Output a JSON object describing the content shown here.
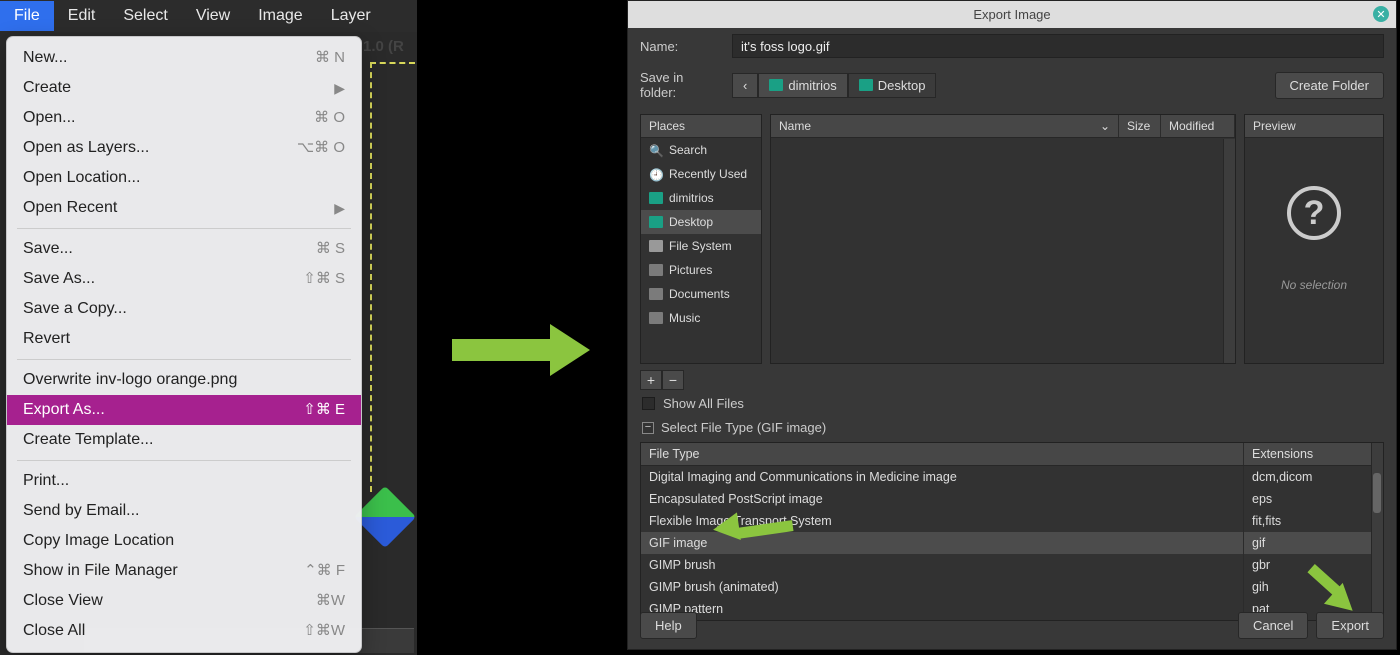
{
  "menubar": [
    "File",
    "Edit",
    "Select",
    "View",
    "Image",
    "Layer"
  ],
  "tab_fragment": "1.0 (R",
  "file_menu": {
    "new": {
      "label": "New...",
      "shortcut": "⌘ N"
    },
    "create": {
      "label": "Create",
      "submenu": true
    },
    "open": {
      "label": "Open...",
      "shortcut": "⌘ O"
    },
    "open_layers": {
      "label": "Open as Layers...",
      "shortcut": "⌥⌘ O"
    },
    "open_loc": {
      "label": "Open Location..."
    },
    "open_recent": {
      "label": "Open Recent",
      "submenu": true
    },
    "save": {
      "label": "Save...",
      "shortcut": "⌘ S"
    },
    "save_as": {
      "label": "Save As...",
      "shortcut": "⇧⌘ S"
    },
    "save_copy": {
      "label": "Save a Copy..."
    },
    "revert": {
      "label": "Revert"
    },
    "overwrite": {
      "label": "Overwrite inv-logo orange.png"
    },
    "export_as": {
      "label": "Export As...",
      "shortcut": "⇧⌘ E"
    },
    "create_tpl": {
      "label": "Create Template..."
    },
    "print": {
      "label": "Print..."
    },
    "send_email": {
      "label": "Send by Email..."
    },
    "copy_loc": {
      "label": "Copy Image Location"
    },
    "show_fm": {
      "label": "Show in File Manager",
      "shortcut": "⌃⌘ F"
    },
    "close_view": {
      "label": "Close View",
      "shortcut": "⌘W"
    },
    "close_all": {
      "label": "Close All",
      "shortcut": "⇧⌘W"
    }
  },
  "dialog": {
    "title": "Export Image",
    "name_label": "Name:",
    "name_value": "it's foss logo.gif",
    "save_in_label": "Save in folder:",
    "path": [
      "dimitrios",
      "Desktop"
    ],
    "create_folder": "Create Folder",
    "places_header": "Places",
    "places": [
      {
        "icon": "search",
        "label": "Search"
      },
      {
        "icon": "clock",
        "label": "Recently Used"
      },
      {
        "icon": "home",
        "label": "dimitrios"
      },
      {
        "icon": "folder",
        "label": "Desktop",
        "selected": true
      },
      {
        "icon": "disk",
        "label": "File System"
      },
      {
        "icon": "gray",
        "label": "Pictures"
      },
      {
        "icon": "gray",
        "label": "Documents"
      },
      {
        "icon": "gray",
        "label": "Music"
      }
    ],
    "file_headers": {
      "name": "Name",
      "size": "Size",
      "modified": "Modified"
    },
    "preview_header": "Preview",
    "no_selection": "No selection",
    "show_all": "Show All Files",
    "select_type": "Select File Type (GIF image)",
    "ft_header": {
      "type": "File Type",
      "ext": "Extensions"
    },
    "file_types": [
      {
        "name": "Digital Imaging and Communications in Medicine image",
        "ext": "dcm,dicom"
      },
      {
        "name": "Encapsulated PostScript image",
        "ext": "eps"
      },
      {
        "name": "Flexible Image Transport System",
        "ext": "fit,fits"
      },
      {
        "name": "GIF image",
        "ext": "gif",
        "selected": true
      },
      {
        "name": "GIMP brush",
        "ext": "gbr"
      },
      {
        "name": "GIMP brush (animated)",
        "ext": "gih"
      },
      {
        "name": "GIMP pattern",
        "ext": "pat"
      }
    ],
    "help": "Help",
    "cancel": "Cancel",
    "export": "Export"
  }
}
